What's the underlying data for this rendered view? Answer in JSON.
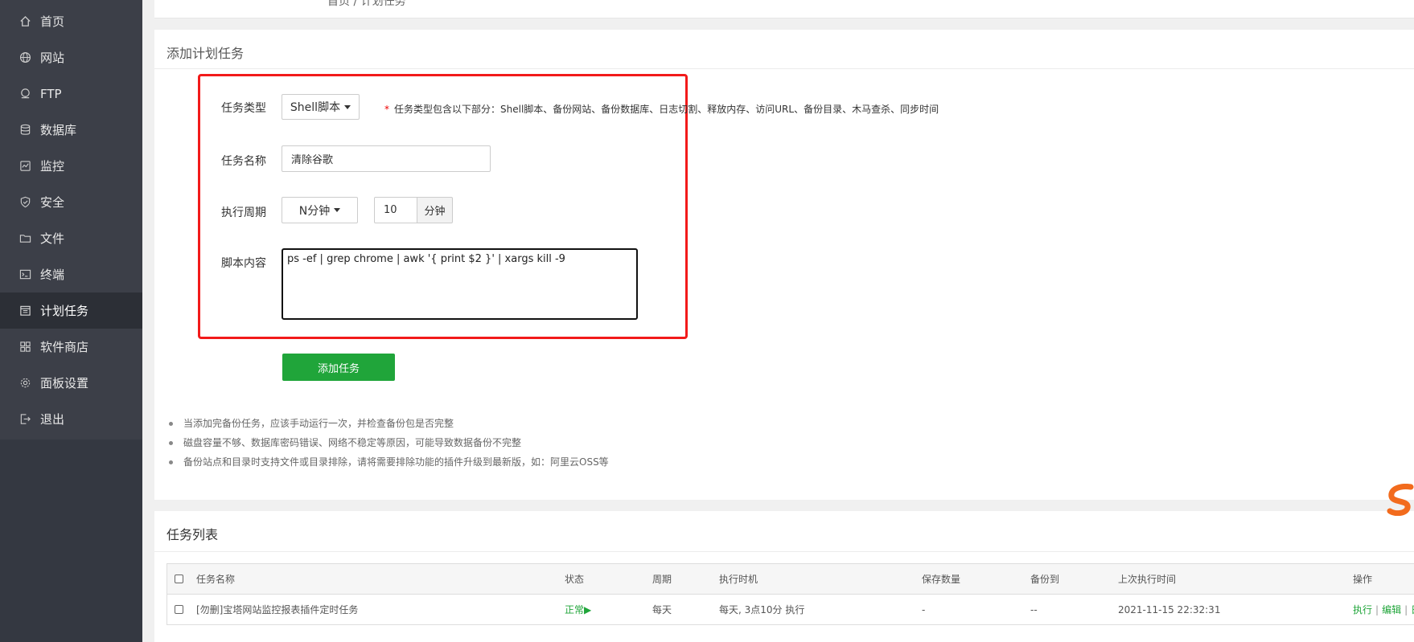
{
  "sidebar": {
    "items": [
      {
        "label": "首页",
        "icon": "home-icon"
      },
      {
        "label": "网站",
        "icon": "globe-icon"
      },
      {
        "label": "FTP",
        "icon": "ftp-icon"
      },
      {
        "label": "数据库",
        "icon": "database-icon"
      },
      {
        "label": "监控",
        "icon": "monitor-icon"
      },
      {
        "label": "安全",
        "icon": "shield-icon"
      },
      {
        "label": "文件",
        "icon": "folder-icon"
      },
      {
        "label": "终端",
        "icon": "terminal-icon"
      },
      {
        "label": "计划任务",
        "icon": "calendar-icon",
        "active": true
      },
      {
        "label": "软件商店",
        "icon": "apps-icon"
      },
      {
        "label": "面板设置",
        "icon": "gear-icon"
      },
      {
        "label": "退出",
        "icon": "logout-icon"
      }
    ]
  },
  "breadcrumb": "首页 / 计划任务",
  "add_task": {
    "title": "添加计划任务",
    "type_label": "任务类型",
    "type_value": "Shell脚本",
    "type_hint_star": "*",
    "type_hint": "任务类型包含以下部分：Shell脚本、备份网站、备份数据库、日志切割、释放内存、访问URL、备份目录、木马查杀、同步时间",
    "name_label": "任务名称",
    "name_value": "清除谷歌",
    "cycle_label": "执行周期",
    "cycle_value": "N分钟",
    "cycle_number": "10",
    "cycle_unit": "分钟",
    "script_label": "脚本内容",
    "script_value": "ps -ef | grep chrome | awk '{ print $2 }' | xargs kill -9",
    "submit_label": "添加任务"
  },
  "notes": [
    "当添加完备份任务，应该手动运行一次，并检查备份包是否完整",
    "磁盘容量不够、数据库密码错误、网络不稳定等原因，可能导致数据备份不完整",
    "备份站点和目录时支持文件或目录排除，请将需要排除功能的插件升级到最新版，如：阿里云OSS等"
  ],
  "task_list": {
    "title": "任务列表",
    "columns": [
      "任务名称",
      "状态",
      "周期",
      "执行时机",
      "保存数量",
      "备份到",
      "上次执行时间",
      "操作"
    ],
    "rows": [
      {
        "name": "[勿删]宝塔网站监控报表插件定时任务",
        "status": "正常▶",
        "cycle": "每天",
        "timing": "每天, 3点10分 执行",
        "keep": "-",
        "backup_to": "--",
        "last_run": "2021-11-15 22:32:31",
        "op_run": "执行",
        "op_sep": "|",
        "op_edit": "编辑",
        "op_more": "日"
      }
    ]
  },
  "colors": {
    "sidebar_bg": "#3c3f48",
    "sidebar_active": "#2c2f36",
    "accent_green": "#20a53a",
    "highlight_red": "#f21a1a"
  }
}
